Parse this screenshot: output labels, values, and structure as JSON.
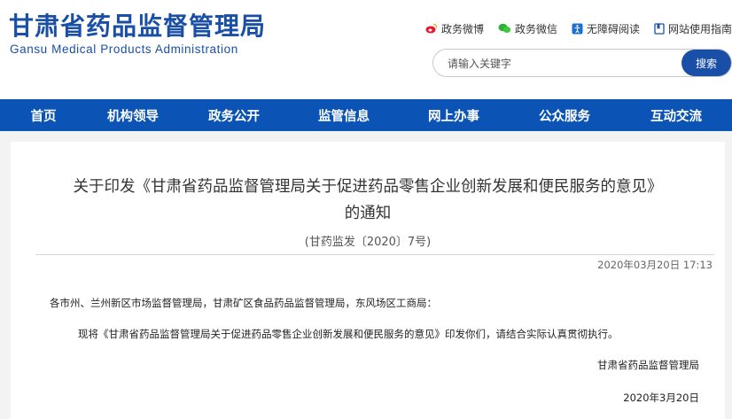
{
  "header": {
    "logo_cn": "甘肃省药品监督管理局",
    "logo_en": "Gansu Medical Products Administration",
    "brand_color": "#1a4fa8"
  },
  "toplinks": [
    {
      "label": "政务微博",
      "icon": "weibo-icon"
    },
    {
      "label": "政务微信",
      "icon": "wechat-icon"
    },
    {
      "label": "无障碍阅读",
      "icon": "accessibility-icon"
    },
    {
      "label": "网站使用指南",
      "icon": "guide-icon"
    }
  ],
  "search": {
    "placeholder": "请输入关键字",
    "button_label": "搜索"
  },
  "nav": {
    "color": "#0b54b5",
    "items": [
      "首页",
      "机构领导",
      "政务公开",
      "监管信息",
      "网上办事",
      "公众服务",
      "互动交流"
    ]
  },
  "article": {
    "title_line1": "关于印发《甘肃省药品监督管理局关于促进药品零售企业创新发展和便民服务的意见》",
    "title_line2": "的通知",
    "doc_number": "(甘药监发〔2020〕7号)",
    "publish_time": "2020年03月20日 17:13",
    "salutation": "各市州、兰州新区市场监督管理局，甘肃矿区食品药品监督管理局，东风场区工商局：",
    "body": "现将《甘肃省药品监督管理局关于促进药品零售企业创新发展和便民服务的意见》印发你们，请结合实际认真贯彻执行。",
    "signature": "甘肃省药品监督管理局",
    "sign_date": "2020年3月20日"
  }
}
